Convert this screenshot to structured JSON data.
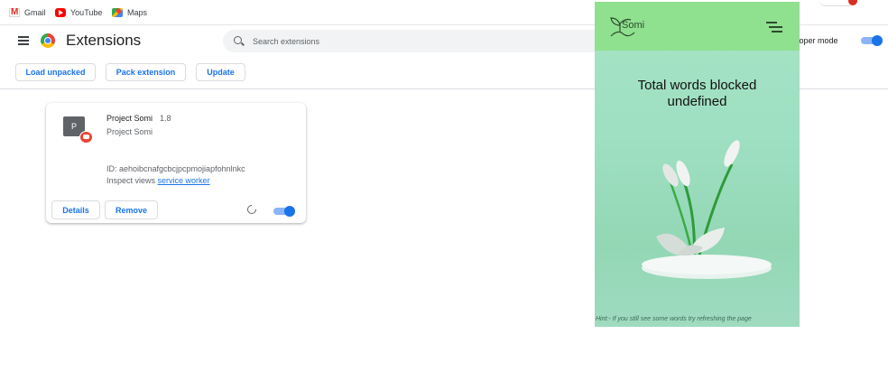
{
  "bookmarks": [
    {
      "label": "Gmail",
      "icon": "gmail-icon"
    },
    {
      "label": "YouTube",
      "icon": "youtube-icon"
    },
    {
      "label": "Maps",
      "icon": "maps-icon"
    }
  ],
  "header": {
    "title": "Extensions",
    "search_placeholder": "Search extensions",
    "devmode_label": "veloper mode",
    "devmode_on": true
  },
  "actions": {
    "load_unpacked": "Load unpacked",
    "pack_extension": "Pack extension",
    "update": "Update"
  },
  "extension_card": {
    "icon_letter": "P",
    "name": "Project Somi",
    "version": "1.8",
    "description": "Project Somi",
    "id_text": "ID: aehoibcnafgcbcjpcpmojiapfohnlnkc",
    "inspect_prefix": "Inspect views",
    "inspect_link": "service worker",
    "details_label": "Details",
    "remove_label": "Remove",
    "enabled": true
  },
  "popup": {
    "logo_text": "Somi",
    "stat_label": "Total words blocked",
    "stat_value": "undefined",
    "hint": "Hint:- If you still see some words try refreshing the page",
    "header_color": "#8fe08f",
    "bg_color": "#9fe0c2"
  },
  "colors": {
    "accent": "#1a73e8"
  }
}
